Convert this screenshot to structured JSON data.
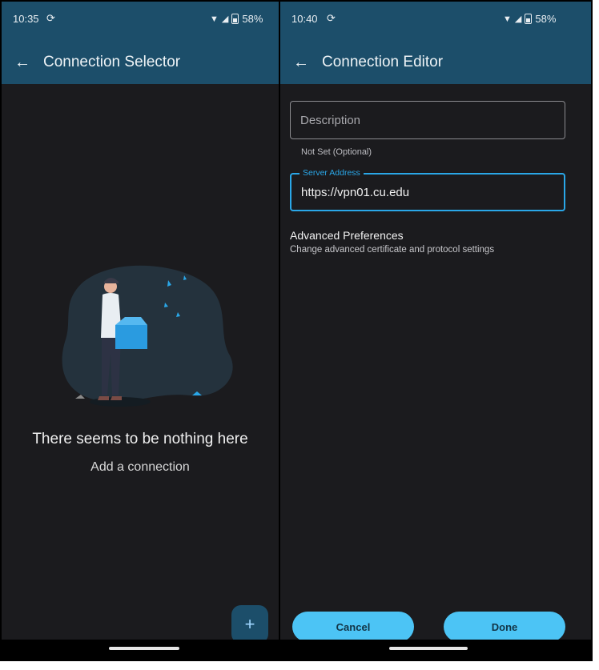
{
  "left_screen": {
    "status": {
      "time": "10:35",
      "sync_icon": "sync-icon",
      "battery": "58%"
    },
    "app_bar": {
      "title": "Connection Selector",
      "back_icon": "back-arrow-icon"
    },
    "empty_state": {
      "title": "There seems to be nothing here",
      "subtitle": "Add a connection",
      "illustration": "person-with-box-illustration"
    },
    "fab": {
      "symbol": "+",
      "icon": "add-icon"
    }
  },
  "right_screen": {
    "status": {
      "time": "10:40",
      "sync_icon": "sync-icon",
      "battery": "58%"
    },
    "app_bar": {
      "title": "Connection Editor",
      "back_icon": "back-arrow-icon"
    },
    "description_field": {
      "placeholder": "Description",
      "helper": "Not Set (Optional)",
      "value": ""
    },
    "server_field": {
      "label": "Server Address",
      "value": "https://vpn01.cu.edu"
    },
    "advanced": {
      "title": "Advanced Preferences",
      "subtitle": "Change advanced certificate and protocol settings"
    },
    "buttons": {
      "cancel": "Cancel",
      "done": "Done"
    }
  },
  "colors": {
    "app_bar": "#1c4e6a",
    "accent": "#2aa7e8",
    "button": "#4cc4f5",
    "background": "#1b1b1e"
  }
}
